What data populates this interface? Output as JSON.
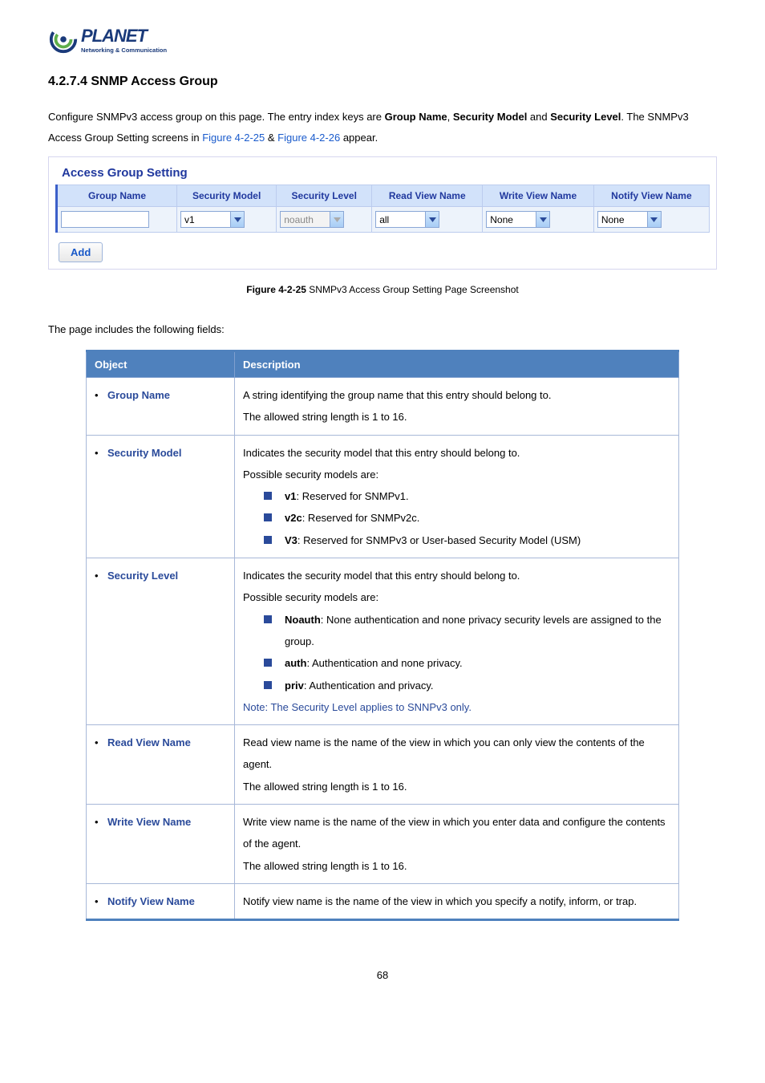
{
  "logo": {
    "brand": "PLANET",
    "tagline": "Networking & Communication"
  },
  "heading": "4.2.7.4 SNMP Access Group",
  "intro": {
    "line1_pre": "Configure SNMPv3 access group on this page. The entry index keys are ",
    "gn": "Group Name",
    "sep1": ", ",
    "sm": "Security Model",
    "sep2": " and ",
    "sl": "Security Level",
    "end1": ". ",
    "line2_pre": "The SNMPv3 Access Group Setting screens in ",
    "fig1": "Figure 4-2-25",
    "amp": " & ",
    "fig2": "Figure 4-2-26",
    "end2": " appear."
  },
  "panel": {
    "title": "Access Group Setting",
    "headers": {
      "c0": "Group Name",
      "c1": "Security Model",
      "c2": "Security Level",
      "c3": "Read View Name",
      "c4": "Write View Name",
      "c5": "Notify View Name"
    },
    "row": {
      "group_name": "",
      "security_model": "v1",
      "security_level": "noauth",
      "read_view": "all",
      "write_view": "None",
      "notify_view": "None"
    },
    "add_button": "Add"
  },
  "caption": {
    "label": "Figure 4-2-25",
    "text": " SNMPv3 Access Group Setting Page Screenshot"
  },
  "fields_intro": "The page includes the following fields:",
  "obj_table": {
    "head_obj": "Object",
    "head_desc": "Description",
    "rows": {
      "group_name": {
        "label": "Group Name",
        "l1": "A string identifying the group name that this entry should belong to.",
        "l2": "The allowed string length is 1 to 16."
      },
      "security_model": {
        "label": "Security Model",
        "l1": "Indicates the security model that this entry should belong to.",
        "l2": "Possible security models are:",
        "items": [
          {
            "b": "v1",
            "rest": ": Reserved for SNMPv1."
          },
          {
            "b": "v2c",
            "rest": ": Reserved for SNMPv2c."
          },
          {
            "b": "V3",
            "rest": ": Reserved for SNMPv3 or User-based Security Model (USM)"
          }
        ]
      },
      "security_level": {
        "label": "Security Level",
        "l1": "Indicates the security model that this entry should belong to.",
        "l2": "Possible security models are:",
        "items": [
          {
            "b": "Noauth",
            "rest": ": None authentication and none privacy security levels are assigned to the group."
          },
          {
            "b": "auth",
            "rest": ": Authentication and none privacy."
          },
          {
            "b": "priv",
            "rest": ": Authentication and privacy."
          }
        ],
        "note": "Note: The Security Level applies to SNNPv3 only."
      },
      "read_view": {
        "label": "Read View Name",
        "l1": "Read view name is the name of the view in which you can only view the contents of the agent.",
        "l2": "The allowed string length is 1 to 16."
      },
      "write_view": {
        "label": "Write View Name",
        "l1": "Write view name is the name of the view in which you enter data and configure the contents of the agent.",
        "l2": "The allowed string length is 1 to 16."
      },
      "notify_view": {
        "label": "Notify View Name",
        "l1": "Notify view name is the name of the view in which you specify a notify, inform, or trap."
      }
    }
  },
  "page_number": "68"
}
